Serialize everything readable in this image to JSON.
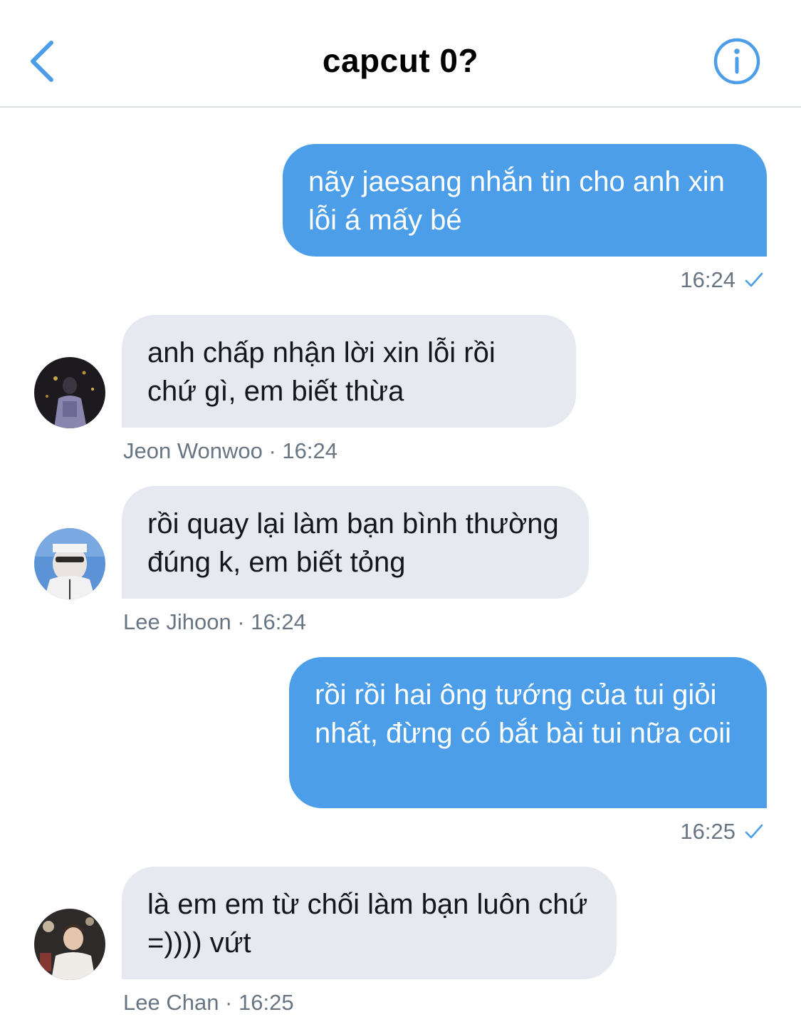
{
  "header": {
    "title": "capcut 0?"
  },
  "messages": [
    {
      "direction": "outgoing",
      "text": "nãy jaesang nhắn tin cho anh xin lỗi á mấy bé",
      "time": "16:24",
      "status_icon": "check-icon"
    },
    {
      "direction": "incoming",
      "text": "anh chấp nhận lời xin lỗi rồi chứ gì, em biết thừa",
      "sender": "Jeon Wonwoo",
      "time": "16:24",
      "meta": "Jeon Wonwoo · 16:24"
    },
    {
      "direction": "incoming",
      "text": "rồi quay lại làm bạn bình thường đúng k, em biết tỏng",
      "sender": "Lee Jihoon",
      "time": "16:24",
      "meta": "Lee Jihoon · 16:24"
    },
    {
      "direction": "outgoing",
      "text": "rồi rồi hai ông tướng của tui giỏi nhất, đừng có bắt bài tui nữa coii",
      "time": "16:25",
      "status_icon": "check-icon"
    },
    {
      "direction": "incoming",
      "text": "là em em từ chối làm bạn luôn chứ =)))) vứt",
      "sender": "Lee Chan",
      "time": "16:25",
      "meta": "Lee Chan · 16:25"
    }
  ],
  "colors": {
    "accent": "#4c9ee8",
    "outgoing_bubble": "#4c9ee8",
    "incoming_bubble": "#e6e9ef",
    "meta_text": "#687684"
  }
}
